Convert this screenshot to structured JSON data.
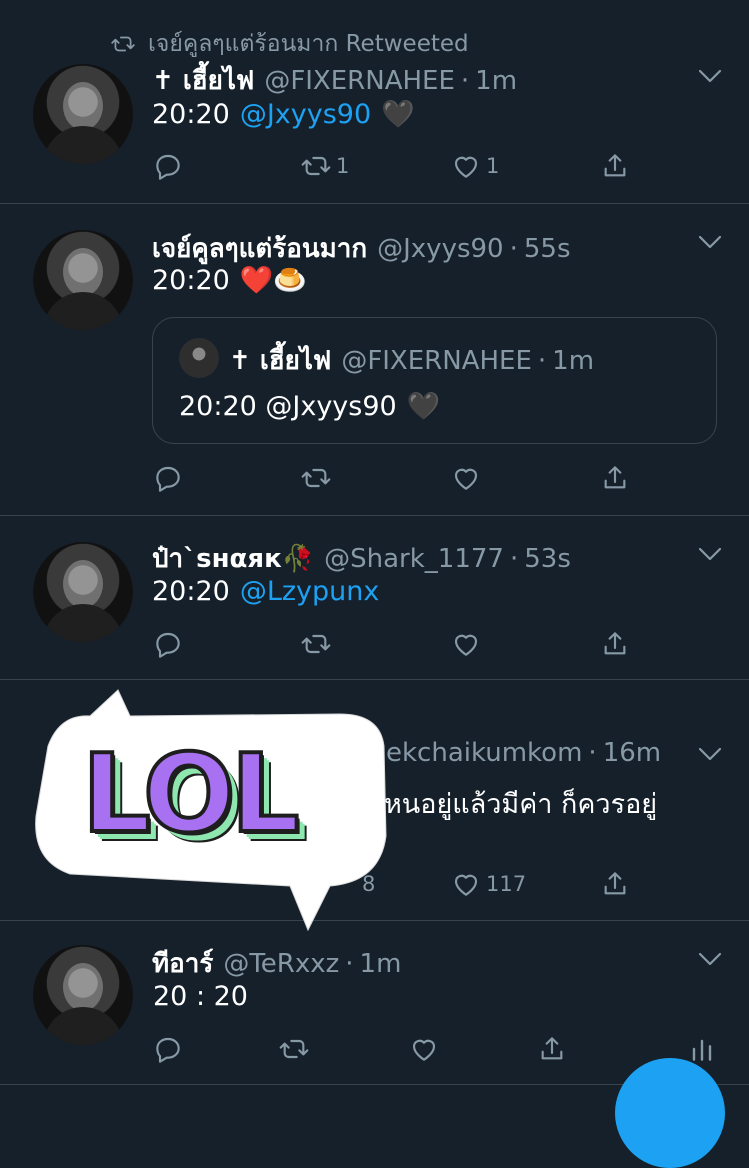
{
  "retweet_context": {
    "text": "เจย์คูลๆแต่ร้อนมาก Retweeted"
  },
  "tweets": [
    {
      "name": "✝ เฮี้ยไฟ",
      "handle": "@FIXERNAHEE",
      "time": "1m",
      "text_prefix": "20:20",
      "mention": "@Jxyys90",
      "emoji": "🖤",
      "retweet_count": "1",
      "like_count": "1"
    },
    {
      "name": "เจย์คูลๆแต่ร้อนมาก",
      "handle": "@Jxyys90",
      "time": "55s",
      "text_prefix": "20:20",
      "emoji": "❤️🍮",
      "quote": {
        "name": "✝ เฮี้ยไฟ",
        "handle": "@FIXERNAHEE",
        "time": "1m",
        "text": "20:20 @Jxyys90",
        "emoji": "🖤"
      }
    },
    {
      "name": "ป๋า`sнαяк🥀",
      "handle": "@Shark_1177",
      "time": "53s",
      "text_prefix": "20:20",
      "mention": "@Lzypunx"
    },
    {
      "handle_partial": "@ekchaikumkom",
      "time": "16m",
      "text_partial": "หนอยู่แล้วมีค่า ก็ควรอยู่",
      "retweet_count_partial": "8",
      "like_count": "117"
    },
    {
      "name": "ทีอาร์",
      "handle": "@TeRxxz",
      "time": "1m",
      "text": "20 : 20"
    }
  ],
  "sticker": {
    "text": "LOL"
  },
  "dot": "·",
  "colors": {
    "background": "#15202b",
    "accent": "#1da1f2",
    "muted": "#8899a6",
    "border": "#38444d"
  },
  "icons": [
    "retweet-icon",
    "reply-icon",
    "like-icon",
    "share-icon",
    "chevron-down-icon",
    "analytics-icon"
  ]
}
